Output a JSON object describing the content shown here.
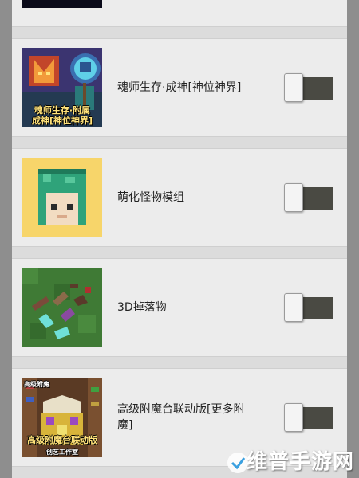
{
  "mods": [
    {
      "title": "魂师生存·成神[神位神界]",
      "thumb_icon": "soul-master-thumbnail",
      "thumb_caption": [
        "魂师生存·附属",
        "成神[神位神界]"
      ],
      "enabled": false
    },
    {
      "title": "萌化怪物模组",
      "thumb_icon": "cute-monster-thumbnail",
      "enabled": false
    },
    {
      "title": "3D掉落物",
      "thumb_icon": "3d-drops-thumbnail",
      "enabled": false
    },
    {
      "title": "高级附魔台联动版[更多附魔]",
      "thumb_icon": "enchant-table-thumbnail",
      "thumb_caption": [
        "高级附魔台联动版",
        "创艺工作室"
      ],
      "thumb_top_label": "高级附魔",
      "enabled": false
    }
  ],
  "watermark": {
    "text": "维普手游网"
  },
  "colors": {
    "card": "#ececec",
    "toggle_track": "#4a4a43",
    "background": "#8e8e8e"
  }
}
